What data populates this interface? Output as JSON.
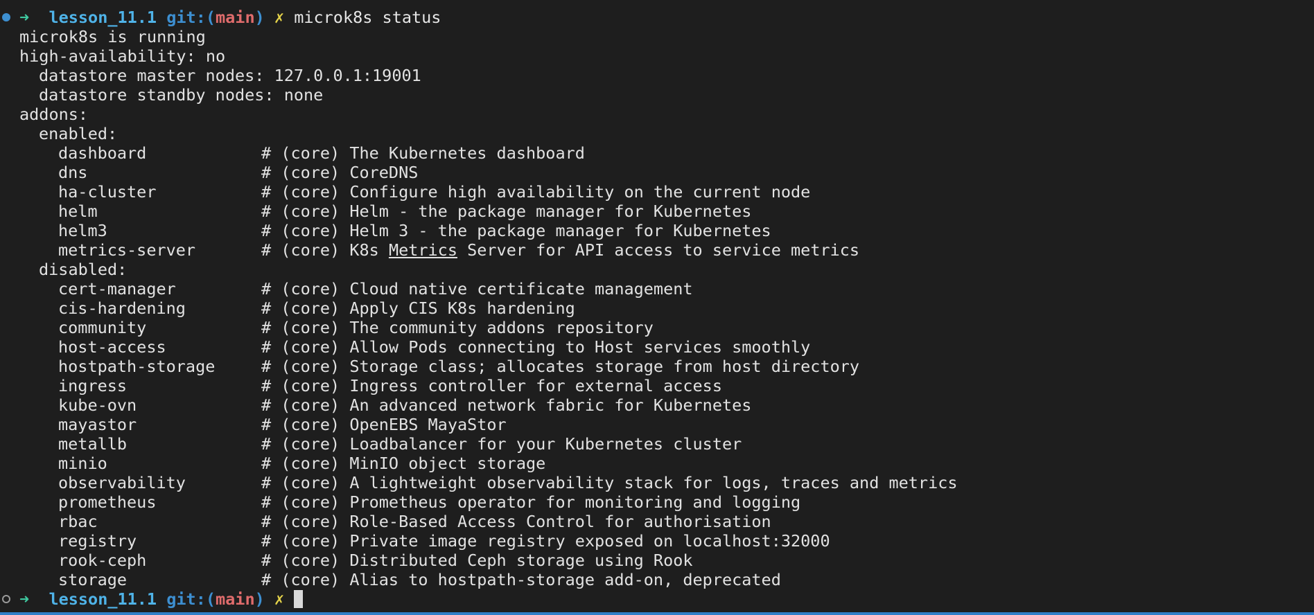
{
  "prompt": {
    "arrow": "➜",
    "dir": "lesson_11.1",
    "git_prefix": "git:(",
    "branch": "main",
    "git_suffix": ")",
    "dirty": "✗"
  },
  "command": "microk8s status",
  "status": {
    "running": "microk8s is running",
    "ha": "high-availability: no",
    "master_nodes": "datastore master nodes: 127.0.0.1:19001",
    "standby_nodes": "datastore standby nodes: none",
    "addons_label": "addons:",
    "enabled_label": "enabled:",
    "disabled_label": "disabled:"
  },
  "enabled": [
    {
      "name": "dashboard",
      "desc": "# (core) The Kubernetes dashboard"
    },
    {
      "name": "dns",
      "desc": "# (core) CoreDNS"
    },
    {
      "name": "ha-cluster",
      "desc": "# (core) Configure high availability on the current node"
    },
    {
      "name": "helm",
      "desc": "# (core) Helm - the package manager for Kubernetes"
    },
    {
      "name": "helm3",
      "desc": "# (core) Helm 3 - the package manager for Kubernetes"
    },
    {
      "name": "metrics-server",
      "desc_a": "# (core) K8s ",
      "desc_link": "Metrics",
      "desc_b": " Server for API access to service metrics"
    }
  ],
  "disabled": [
    {
      "name": "cert-manager",
      "desc": "# (core) Cloud native certificate management"
    },
    {
      "name": "cis-hardening",
      "desc": "# (core) Apply CIS K8s hardening"
    },
    {
      "name": "community",
      "desc": "# (core) The community addons repository"
    },
    {
      "name": "host-access",
      "desc": "# (core) Allow Pods connecting to Host services smoothly"
    },
    {
      "name": "hostpath-storage",
      "desc": "# (core) Storage class; allocates storage from host directory"
    },
    {
      "name": "ingress",
      "desc": "# (core) Ingress controller for external access"
    },
    {
      "name": "kube-ovn",
      "desc": "# (core) An advanced network fabric for Kubernetes"
    },
    {
      "name": "mayastor",
      "desc": "# (core) OpenEBS MayaStor"
    },
    {
      "name": "metallb",
      "desc": "# (core) Loadbalancer for your Kubernetes cluster"
    },
    {
      "name": "minio",
      "desc": "# (core) MinIO object storage"
    },
    {
      "name": "observability",
      "desc": "# (core) A lightweight observability stack for logs, traces and metrics"
    },
    {
      "name": "prometheus",
      "desc": "# (core) Prometheus operator for monitoring and logging"
    },
    {
      "name": "rbac",
      "desc": "# (core) Role-Based Access Control for authorisation"
    },
    {
      "name": "registry",
      "desc": "# (core) Private image registry exposed on localhost:32000"
    },
    {
      "name": "rook-ceph",
      "desc": "# (core) Distributed Ceph storage using Rook"
    },
    {
      "name": "storage",
      "desc": "# (core) Alias to hostpath-storage add-on, deprecated"
    }
  ],
  "colors": {
    "background": "#1e1e1e",
    "arrow": "#3fc9a0",
    "dir": "#4fb3e8",
    "git": "#3d8fd1",
    "branch": "#e06c6c",
    "dirty": "#e5d34a",
    "status_bar": "#2f7fc8"
  }
}
